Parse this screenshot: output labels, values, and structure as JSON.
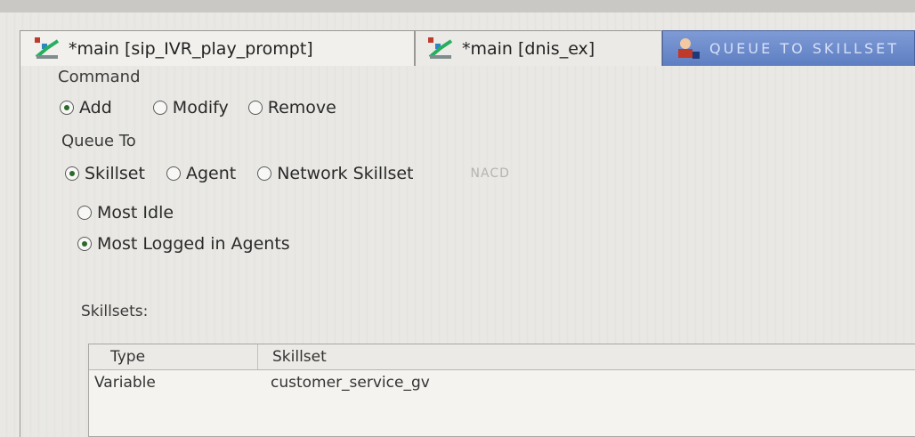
{
  "tabs": [
    {
      "label": "*main [sip_IVR_play_prompt]",
      "icon": "flow-editor-icon",
      "active": false
    },
    {
      "label": "*main [dnis_ex]",
      "icon": "flow-editor-icon",
      "active": false
    },
    {
      "label": "QUEUE TO SKILLSET",
      "icon": "queue-agent-icon",
      "active": true
    }
  ],
  "command": {
    "label": "Command",
    "options": [
      {
        "label": "Add",
        "selected": true
      },
      {
        "label": "Modify",
        "selected": false
      },
      {
        "label": "Remove",
        "selected": false
      }
    ]
  },
  "queue_to": {
    "label": "Queue To",
    "options": [
      {
        "label": "Skillset",
        "selected": true
      },
      {
        "label": "Agent",
        "selected": false
      },
      {
        "label": "Network Skillset",
        "selected": false
      }
    ],
    "disabled_option": "NACD"
  },
  "routing": {
    "options": [
      {
        "label": "Most Idle",
        "selected": false
      },
      {
        "label": "Most Logged in Agents",
        "selected": true
      }
    ]
  },
  "skillsets": {
    "label": "Skillsets:",
    "columns": [
      "Type",
      "Skillset"
    ],
    "rows": [
      {
        "type": "Variable",
        "skillset": "customer_service_gv"
      }
    ]
  },
  "colors": {
    "active_tab": "#5d7ec2",
    "radio_selected": "#2a6b2a",
    "background": "#e9e8e4"
  }
}
